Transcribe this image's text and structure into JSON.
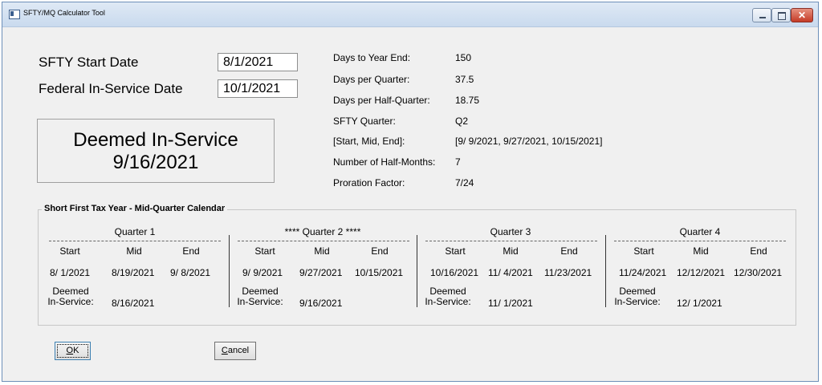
{
  "window": {
    "title": "SFTY/MQ Calculator Tool",
    "minimize": "",
    "maximize": "",
    "close": "✕"
  },
  "inputs": {
    "sfty_start_label": "SFTY Start Date",
    "sfty_start_value": "8/1/2021",
    "federal_label": "Federal In-Service Date",
    "federal_value": "10/1/2021"
  },
  "deemed": {
    "title": "Deemed In-Service",
    "date": "9/16/2021"
  },
  "info": [
    {
      "label": "Days to Year End:",
      "value": "150"
    },
    {
      "label": "Days per Quarter:",
      "value": "37.5"
    },
    {
      "label": "Days per Half-Quarter:",
      "value": "18.75"
    },
    {
      "label": "SFTY Quarter:",
      "value": "Q2"
    },
    {
      "label": "[Start, Mid, End]:",
      "value": "[9/ 9/2021, 9/27/2021, 10/15/2021]"
    },
    {
      "label": "Number of Half-Months:",
      "value": "7"
    },
    {
      "label": "Proration Factor:",
      "value": "7/24"
    }
  ],
  "calendar": {
    "title": "Short First Tax Year - Mid-Quarter Calendar",
    "headers": [
      "Start",
      "Mid",
      "End"
    ],
    "deemed_label_1": "Deemed",
    "deemed_label_2": "In-Service:",
    "quarters": [
      {
        "title": "Quarter 1",
        "start": "8/ 1/2021",
        "mid": "8/19/2021",
        "end": "9/ 8/2021",
        "deemed": "8/16/2021"
      },
      {
        "title": "**** Quarter 2 ****",
        "start": "9/ 9/2021",
        "mid": "9/27/2021",
        "end": "10/15/2021",
        "deemed": "9/16/2021"
      },
      {
        "title": "Quarter 3",
        "start": "10/16/2021",
        "mid": "11/ 4/2021",
        "end": "11/23/2021",
        "deemed": "11/ 1/2021"
      },
      {
        "title": "Quarter 4",
        "start": "11/24/2021",
        "mid": "12/12/2021",
        "end": "12/30/2021",
        "deemed": "12/ 1/2021"
      }
    ]
  },
  "buttons": {
    "ok_mnemonic": "O",
    "ok_rest": "K",
    "cancel_mnemonic": "C",
    "cancel_rest": "ancel"
  }
}
